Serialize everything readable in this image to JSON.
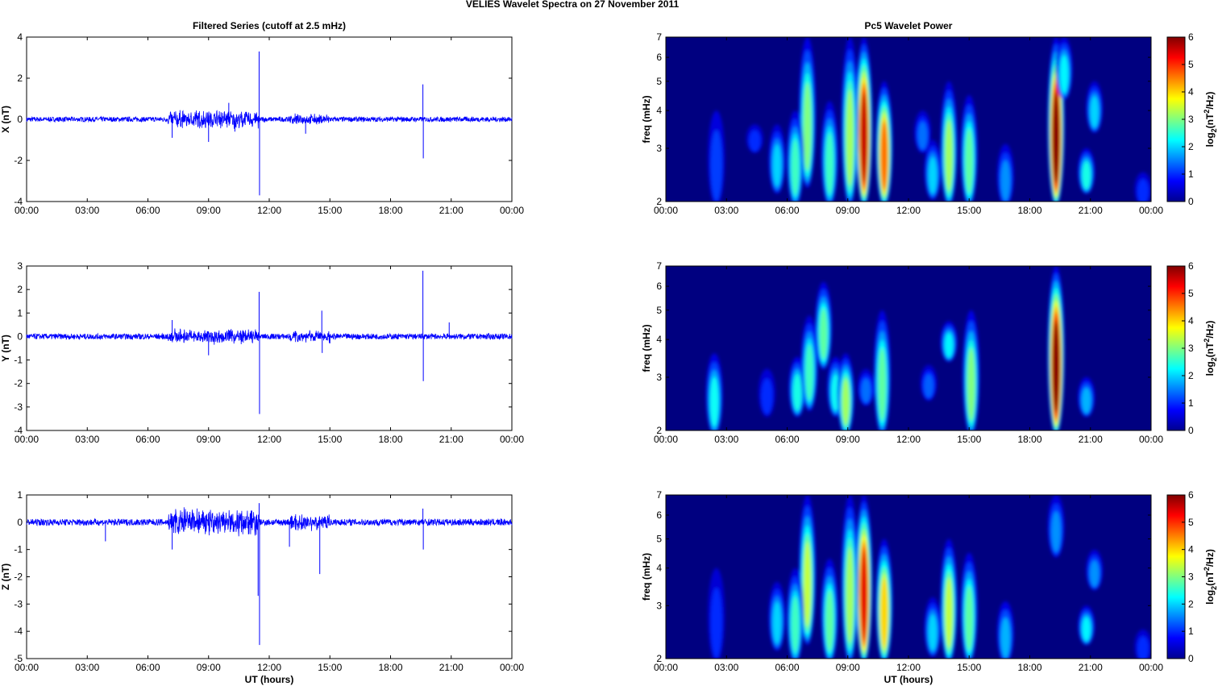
{
  "title": "VELIES Wavelet Spectra on 27 November  2011",
  "chart_data": [
    {
      "type": "line",
      "title": "Filtered Series (cutoff at 2.5 mHz)",
      "ylabel": "X (nT)",
      "xlabel": "",
      "xlim": [
        0,
        24
      ],
      "ylim": [
        -4,
        4
      ],
      "yticks": [
        -4,
        -2,
        0,
        2,
        4
      ],
      "color": "#0000ff",
      "noise_amplitude": 0.12,
      "active_intervals": [
        [
          7,
          11.5,
          0.35
        ],
        [
          13,
          15,
          0.2
        ]
      ],
      "spikes": [
        [
          11.5,
          3.3
        ],
        [
          11.52,
          -3.7
        ],
        [
          19.6,
          1.7
        ],
        [
          19.62,
          -1.9
        ],
        [
          7.2,
          -0.9
        ],
        [
          9.0,
          -1.1
        ],
        [
          10.0,
          0.8
        ],
        [
          13.8,
          -0.7
        ],
        [
          10.3,
          -0.6
        ]
      ]
    },
    {
      "type": "line",
      "title": "",
      "ylabel": "Y (nT)",
      "xlabel": "",
      "xlim": [
        0,
        24
      ],
      "ylim": [
        -4,
        3
      ],
      "yticks": [
        -4,
        -3,
        -2,
        -1,
        0,
        1,
        2,
        3
      ],
      "color": "#0000ff",
      "noise_amplitude": 0.12,
      "active_intervals": [
        [
          7,
          11.5,
          0.25
        ],
        [
          13,
          15,
          0.2
        ]
      ],
      "spikes": [
        [
          11.5,
          1.9
        ],
        [
          11.52,
          -3.3
        ],
        [
          19.6,
          2.8
        ],
        [
          19.62,
          -1.9
        ],
        [
          14.6,
          1.1
        ],
        [
          14.62,
          -0.7
        ],
        [
          7.2,
          0.7
        ],
        [
          9.0,
          -0.8
        ],
        [
          20.9,
          0.6
        ]
      ]
    },
    {
      "type": "line",
      "title": "",
      "ylabel": "Z (nT)",
      "xlabel": "UT (hours)",
      "xlim": [
        0,
        24
      ],
      "ylim": [
        -5,
        1
      ],
      "yticks": [
        -5,
        -4,
        -3,
        -2,
        -1,
        0,
        1
      ],
      "color": "#0000ff",
      "noise_amplitude": 0.12,
      "active_intervals": [
        [
          7,
          11.5,
          0.4
        ],
        [
          13,
          15,
          0.25
        ]
      ],
      "spikes": [
        [
          11.5,
          0.7
        ],
        [
          11.52,
          -4.5
        ],
        [
          11.45,
          -2.7
        ],
        [
          14.5,
          -1.9
        ],
        [
          7.2,
          -1.0
        ],
        [
          3.9,
          -0.7
        ],
        [
          19.6,
          0.5
        ],
        [
          19.62,
          -1.0
        ],
        [
          13.0,
          -0.9
        ]
      ]
    },
    {
      "type": "heatmap",
      "title": "Pc5 Wavelet Power",
      "ylabel": "freq (mHz)",
      "xlabel": "",
      "xlim": [
        0,
        24
      ],
      "ylim": [
        2,
        7
      ],
      "yscale": "log",
      "yticks": [
        2,
        3,
        4,
        5,
        6,
        7
      ],
      "colorbar": {
        "label": "log2(nT^2/Hz)",
        "range": [
          0,
          6
        ],
        "ticks": [
          0,
          1,
          2,
          3,
          4,
          5,
          6
        ]
      },
      "blobs": [
        [
          9.8,
          2,
          7,
          5.6
        ],
        [
          9.1,
          2,
          7,
          3.2
        ],
        [
          10.8,
          2,
          5,
          4.6
        ],
        [
          7.0,
          2.3,
          7,
          3.0
        ],
        [
          6.4,
          2,
          4,
          2.6
        ],
        [
          5.5,
          2.2,
          3.6,
          2.0
        ],
        [
          8.1,
          2,
          4.3,
          2.6
        ],
        [
          14.0,
          2,
          5,
          3.2
        ],
        [
          15.0,
          2,
          4.5,
          2.8
        ],
        [
          19.3,
          2,
          7,
          6.0
        ],
        [
          19.7,
          4.5,
          7,
          2.2
        ],
        [
          20.8,
          2.2,
          3,
          2.4
        ],
        [
          21.2,
          3.5,
          5,
          2.0
        ],
        [
          2.5,
          2,
          4,
          1.1
        ],
        [
          16.8,
          2,
          3.1,
          1.6
        ],
        [
          13.2,
          2.1,
          3.2,
          2.0
        ],
        [
          12.7,
          3,
          4,
          1.4
        ],
        [
          4.4,
          3,
          3.6,
          1.0
        ],
        [
          23.6,
          2,
          2.5,
          1.0
        ]
      ]
    },
    {
      "type": "heatmap",
      "title": "",
      "ylabel": "freq (mHz)",
      "xlabel": "",
      "xlim": [
        0,
        24
      ],
      "ylim": [
        2,
        7
      ],
      "yscale": "log",
      "yticks": [
        2,
        3,
        4,
        5,
        6,
        7
      ],
      "colorbar": {
        "label": "log2(nT^2/Hz)",
        "range": [
          0,
          6
        ],
        "ticks": [
          0,
          1,
          2,
          3,
          4,
          5,
          6
        ]
      },
      "blobs": [
        [
          2.4,
          2,
          3.6,
          2.3
        ],
        [
          5.0,
          2.3,
          3.2,
          1.0
        ],
        [
          6.5,
          2.3,
          3.5,
          2.4
        ],
        [
          7.1,
          2.4,
          4.8,
          2.6
        ],
        [
          7.8,
          3.3,
          6.2,
          2.8
        ],
        [
          8.4,
          2.3,
          3.5,
          2.3
        ],
        [
          8.9,
          2,
          3.6,
          3.2
        ],
        [
          10.7,
          2,
          5,
          2.8
        ],
        [
          14.0,
          3.5,
          4.6,
          2.2
        ],
        [
          15.1,
          2,
          5,
          3.0
        ],
        [
          19.3,
          2,
          7,
          6.0
        ],
        [
          20.8,
          2.3,
          3,
          1.8
        ],
        [
          9.9,
          2.5,
          3.2,
          1.4
        ],
        [
          13.0,
          2.6,
          3.3,
          1.3
        ]
      ]
    },
    {
      "type": "heatmap",
      "title": "",
      "ylabel": "freq (mHz)",
      "xlabel": "UT (hours)",
      "xlim": [
        0,
        24
      ],
      "ylim": [
        2,
        7
      ],
      "yscale": "log",
      "yticks": [
        2,
        3,
        4,
        5,
        6,
        7
      ],
      "colorbar": {
        "label": "log2(nT^2/Hz)",
        "range": [
          0,
          6
        ],
        "ticks": [
          0,
          1,
          2,
          3,
          4,
          5,
          6
        ]
      },
      "blobs": [
        [
          9.8,
          2,
          7,
          5.4
        ],
        [
          9.1,
          2,
          7,
          3.2
        ],
        [
          10.8,
          2,
          5,
          4.0
        ],
        [
          7.0,
          2.3,
          7,
          3.4
        ],
        [
          6.4,
          2,
          4,
          2.6
        ],
        [
          5.5,
          2.2,
          3.6,
          2.0
        ],
        [
          8.1,
          2,
          4.3,
          2.8
        ],
        [
          14.0,
          2,
          5,
          3.4
        ],
        [
          15.0,
          2,
          4.5,
          2.8
        ],
        [
          16.8,
          2,
          3.1,
          1.8
        ],
        [
          13.2,
          2.1,
          3.2,
          2.0
        ],
        [
          19.3,
          4.5,
          7,
          1.6
        ],
        [
          20.8,
          2.3,
          3,
          2.2
        ],
        [
          21.2,
          3.5,
          4.6,
          1.6
        ],
        [
          2.5,
          2,
          4,
          1.0
        ],
        [
          23.6,
          2,
          2.5,
          1.0
        ]
      ]
    }
  ],
  "xticklabels": [
    "00:00",
    "03:00",
    "06:00",
    "09:00",
    "12:00",
    "15:00",
    "18:00",
    "21:00",
    "00:00"
  ]
}
